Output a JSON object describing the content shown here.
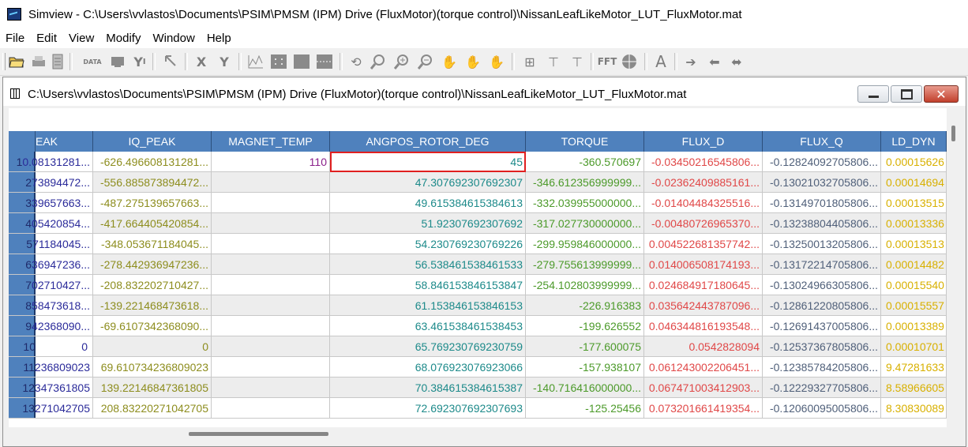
{
  "app": {
    "title": "Simview - C:\\Users\\vvlastos\\Documents\\PSIM\\PMSM (IPM) Drive (FluxMotor)(torque control)\\NissanLeafLikeMotor_LUT_FluxMotor.mat"
  },
  "menu": [
    "File",
    "Edit",
    "View",
    "Modify",
    "Window",
    "Help"
  ],
  "toolbar": {
    "icons": [
      "open-icon",
      "print-icon",
      "print-preview-icon",
      "data-icon",
      "screen-icon",
      "y-axis-icon",
      "select-icon",
      "x-axis-icon",
      "y-icon",
      "plot-icon",
      "grid-icon",
      "grid2-icon",
      "grid3-icon",
      "undo-icon",
      "zoom-icon",
      "zoom-in-icon",
      "zoom-out-icon",
      "pan-icon",
      "pan-x-icon",
      "pan-y-icon",
      "marker-icon",
      "measure-icon",
      "measure2-icon",
      "fft-icon",
      "circle-icon",
      "text-icon",
      "arrow-right-icon",
      "arrow-left-icon",
      "arrow-both-icon"
    ],
    "fft_label": "FFT",
    "x_label": "X",
    "y_label": "Y",
    "a_label": "A",
    "data_label": "DATA"
  },
  "child_window": {
    "title": "C:\\Users\\vvlastos\\Documents\\PSIM\\PMSM (IPM) Drive (FluxMotor)(torque control)\\NissanLeafLikeMotor_LUT_FluxMotor.mat",
    "close_glyph": "✕"
  },
  "grid": {
    "headers": [
      "EAK",
      "IQ_PEAK",
      "MAGNET_TEMP",
      "ANGPOS_ROTOR_DEG",
      "TORQUE",
      "FLUX_D",
      "FLUX_Q",
      "LD_DYN"
    ],
    "rows": [
      {
        "idx": "1",
        "c0": "0.08131281...",
        "iq": "-626.496608131281...",
        "mag": "110",
        "ang": "45",
        "tor": "-360.570697",
        "fd": "-0.03450216545806...",
        "fq": "-0.12824092705806...",
        "ld": "0.00015626"
      },
      {
        "idx": "2",
        "c0": "73894472...",
        "iq": "-556.885873894472...",
        "mag": "",
        "ang": "47.307692307692307",
        "tor": "-346.612356999999...",
        "fd": "-0.02362409885161...",
        "fq": "-0.13021032705806...",
        "ld": "0.00014694"
      },
      {
        "idx": "3",
        "c0": "39657663...",
        "iq": "-487.275139657663...",
        "mag": "",
        "ang": "49.615384615384613",
        "tor": "-332.039955000000...",
        "fd": "-0.01404484325516...",
        "fq": "-0.13149701805806...",
        "ld": "0.00013515"
      },
      {
        "idx": "4",
        "c0": "05420854...",
        "iq": "-417.664405420854...",
        "mag": "",
        "ang": "51.92307692307692",
        "tor": "-317.027730000000...",
        "fd": "-0.00480726965370...",
        "fq": "-0.13238804405806...",
        "ld": "0.00013336"
      },
      {
        "idx": "5",
        "c0": "71184045...",
        "iq": "-348.053671184045...",
        "mag": "",
        "ang": "54.230769230769226",
        "tor": "-299.959846000000...",
        "fd": "0.004522681357742...",
        "fq": "-0.13250013205806...",
        "ld": "0.00013513"
      },
      {
        "idx": "6",
        "c0": "36947236...",
        "iq": "-278.442936947236...",
        "mag": "",
        "ang": "56.538461538461533",
        "tor": "-279.755613999999...",
        "fd": "0.014006508174193...",
        "fq": "-0.13172214705806...",
        "ld": "0.00014482"
      },
      {
        "idx": "7",
        "c0": "02710427...",
        "iq": "-208.832202710427...",
        "mag": "",
        "ang": "58.846153846153847",
        "tor": "-254.102803999999...",
        "fd": "0.024684917180645...",
        "fq": "-0.13024966305806...",
        "ld": "0.00015540"
      },
      {
        "idx": "8",
        "c0": "58473618...",
        "iq": "-139.221468473618...",
        "mag": "",
        "ang": "61.153846153846153",
        "tor": "-226.916383",
        "fd": "0.035642443787096...",
        "fq": "-0.12861220805806...",
        "ld": "0.00015557"
      },
      {
        "idx": "9",
        "c0": "42368090...",
        "iq": "-69.6107342368090...",
        "mag": "",
        "ang": "63.461538461538453",
        "tor": "-199.626552",
        "fd": "0.046344816193548...",
        "fq": "-0.12691437005806...",
        "ld": "0.00013389"
      },
      {
        "idx": "10",
        "c0": "0",
        "iq": "0",
        "mag": "",
        "ang": "65.769230769230759",
        "tor": "-177.600075",
        "fd": "0.0542828094",
        "fq": "-0.12537367805806...",
        "ld": "0.00010701"
      },
      {
        "idx": "11",
        "c0": "236809023",
        "iq": "69.610734236809023",
        "mag": "",
        "ang": "68.076923076923066",
        "tor": "-157.938107",
        "fd": "0.061243002206451...",
        "fq": "-0.12385784205806...",
        "ld": "9.47281633"
      },
      {
        "idx": "12",
        "c0": "347361805",
        "iq": "139.22146847361805",
        "mag": "",
        "ang": "70.384615384615387",
        "tor": "-140.716416000000...",
        "fd": "0.067471003412903...",
        "fq": "-0.12229327705806...",
        "ld": "8.58966605"
      },
      {
        "idx": "13",
        "c0": "271042705",
        "iq": "208.83220271042705",
        "mag": "",
        "ang": "72.692307692307693",
        "tor": "-125.25456",
        "fd": "0.073201661419354...",
        "fq": "-0.12060095005806...",
        "ld": "8.30830089"
      }
    ]
  }
}
